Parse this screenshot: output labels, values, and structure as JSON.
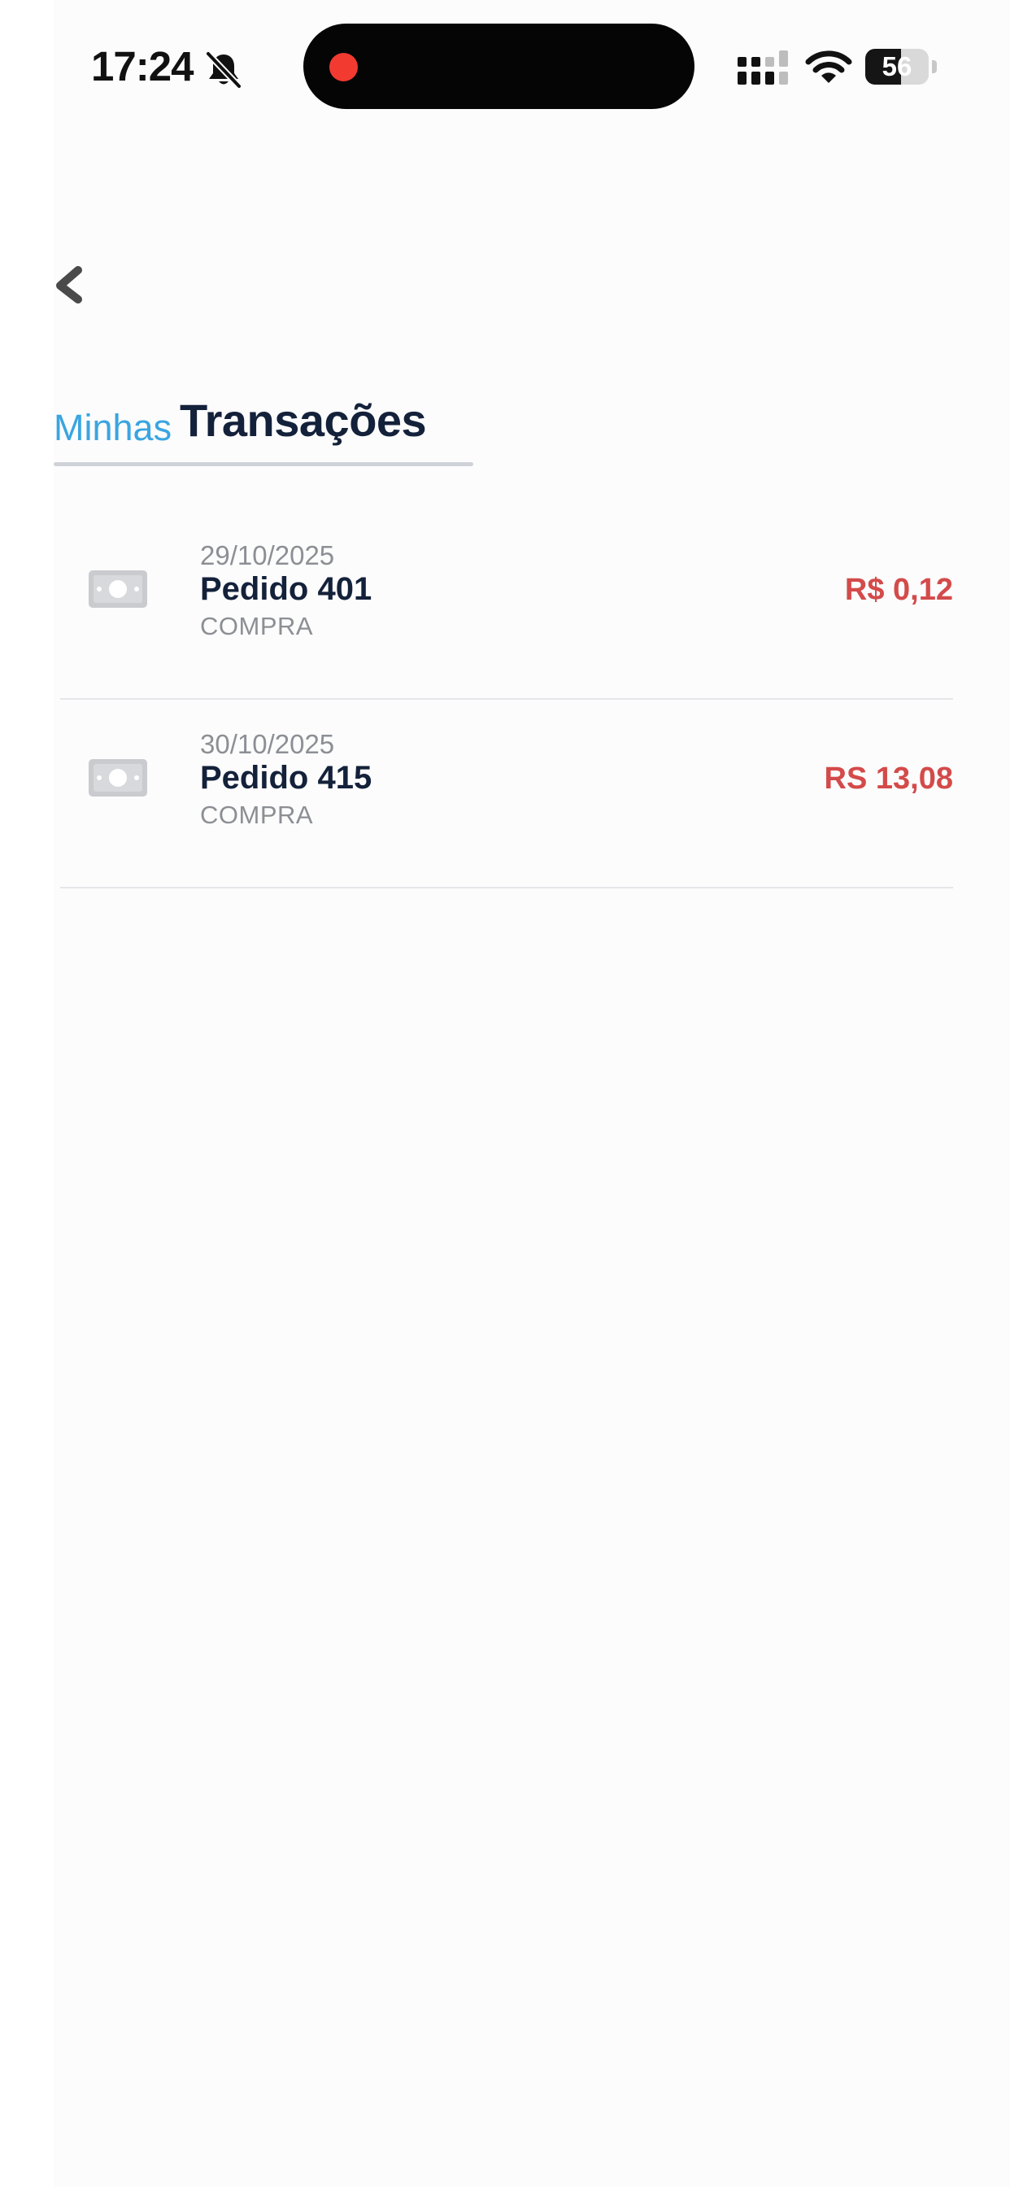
{
  "status_bar": {
    "time": "17:24",
    "battery_level": "56",
    "icons": [
      "bell-slash-icon",
      "cellular-signal-icon",
      "wifi-icon",
      "battery-icon"
    ],
    "recording_indicator_color": "#f33a30"
  },
  "nav": {
    "back_icon": "chevron-left-icon"
  },
  "header": {
    "prefix": "Minhas",
    "title": "Transações",
    "prefix_color": "#3aa5e0",
    "title_color": "#14213a"
  },
  "transactions": [
    {
      "date": "29/10/2025",
      "title": "Pedido 401",
      "type": "COMPRA",
      "amount": "R$ 0,12",
      "icon": "cash-icon"
    },
    {
      "date": "30/10/2025",
      "title": "Pedido 415",
      "type": "COMPRA",
      "amount": "RS 13,08",
      "icon": "cash-icon"
    }
  ],
  "colors": {
    "amount_negative": "#d44a4a",
    "background": "#fcfcfd",
    "divider": "#e4e6e9"
  }
}
